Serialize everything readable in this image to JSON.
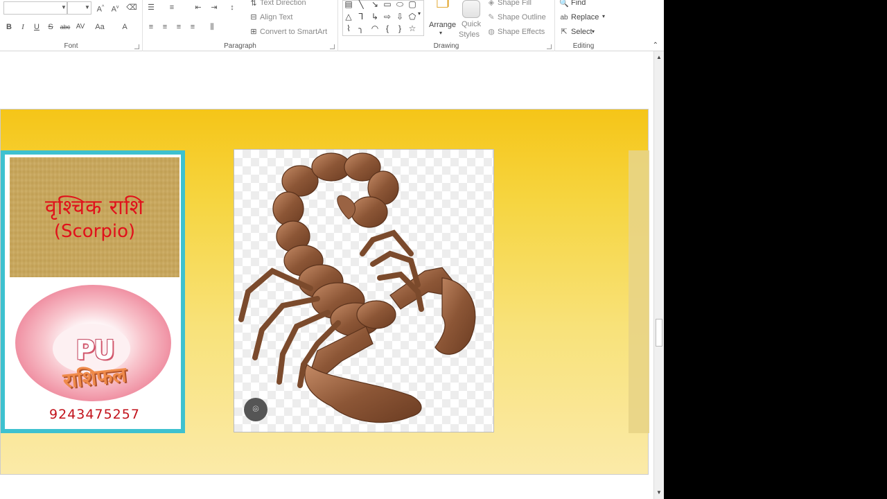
{
  "ribbon": {
    "font_group": {
      "label": "Font",
      "buttons": [
        "B",
        "I",
        "U",
        "S",
        "abc",
        "AV",
        "Aa",
        "A"
      ]
    },
    "paragraph_group": {
      "label": "Paragraph",
      "text_direction": "Text Direction",
      "align_text": "Align Text",
      "convert_smartart": "Convert to SmartArt"
    },
    "drawing_group": {
      "label": "Drawing",
      "arrange": "Arrange",
      "quick_styles_line1": "Quick",
      "quick_styles_line2": "Styles",
      "shape_fill": "Shape Fill",
      "shape_outline": "Shape Outline",
      "shape_effects": "Shape Effects"
    },
    "editing_group": {
      "label": "Editing",
      "find": "Find",
      "replace": "Replace",
      "select": "Select"
    }
  },
  "slide": {
    "card": {
      "title_hindi": "वृश्चिक राशि",
      "title_english": "(Scorpio)",
      "logo_top": "PU",
      "logo_bottom": "राशिफल",
      "phone": "9243475257"
    },
    "colors": {
      "slide_gradient_top": "#f5c518",
      "slide_gradient_bottom": "#fbeaa8",
      "card_border": "#3ec1cf",
      "title_red": "#e0121b"
    }
  },
  "icons": [
    "bold-icon",
    "italic-icon",
    "underline-icon",
    "strikethrough-icon",
    "bullets-icon",
    "numbering-icon",
    "align-left-icon",
    "align-center-icon",
    "align-right-icon",
    "justify-icon",
    "find-icon",
    "replace-icon",
    "select-icon",
    "google-lens-icon",
    "scorpion-image"
  ]
}
